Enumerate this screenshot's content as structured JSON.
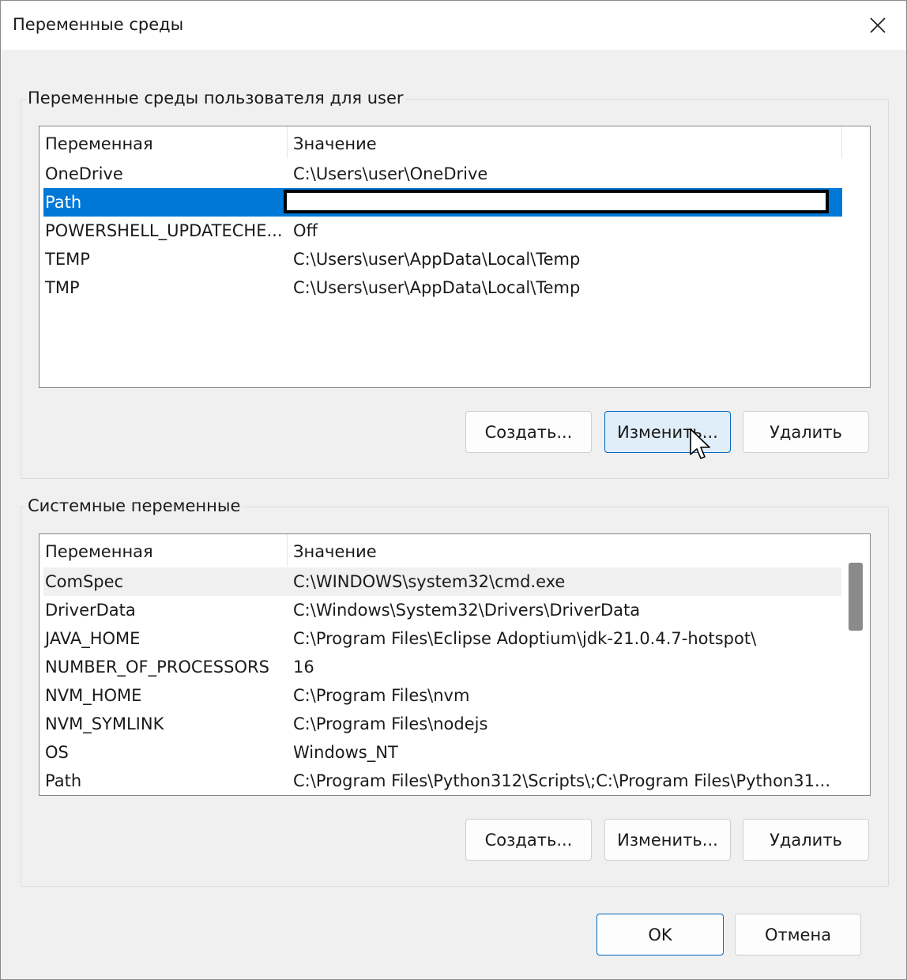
{
  "window": {
    "title": "Переменные среды"
  },
  "user_group": {
    "label": "Переменные среды пользователя для user",
    "columns": [
      "Переменная",
      "Значение"
    ],
    "rows": [
      {
        "name": "OneDrive",
        "value": "C:\\Users\\user\\OneDrive"
      },
      {
        "name": "Path",
        "value": ""
      },
      {
        "name": "POWERSHELL_UPDATECHE...",
        "value": "Off"
      },
      {
        "name": "TEMP",
        "value": "C:\\Users\\user\\AppData\\Local\\Temp"
      },
      {
        "name": "TMP",
        "value": "C:\\Users\\user\\AppData\\Local\\Temp"
      }
    ],
    "buttons": {
      "create": "Создать...",
      "edit": "Изменить...",
      "delete": "Удалить"
    }
  },
  "system_group": {
    "label": "Системные переменные",
    "columns": [
      "Переменная",
      "Значение"
    ],
    "rows": [
      {
        "name": "ComSpec",
        "value": "C:\\WINDOWS\\system32\\cmd.exe"
      },
      {
        "name": "DriverData",
        "value": "C:\\Windows\\System32\\Drivers\\DriverData"
      },
      {
        "name": "JAVA_HOME",
        "value": "C:\\Program Files\\Eclipse Adoptium\\jdk-21.0.4.7-hotspot\\"
      },
      {
        "name": "NUMBER_OF_PROCESSORS",
        "value": "16"
      },
      {
        "name": "NVM_HOME",
        "value": "C:\\Program Files\\nvm"
      },
      {
        "name": "NVM_SYMLINK",
        "value": "C:\\Program Files\\nodejs"
      },
      {
        "name": "OS",
        "value": "Windows_NT"
      },
      {
        "name": "Path",
        "value": "C:\\Program Files\\Python312\\Scripts\\;C:\\Program Files\\Python31..."
      }
    ],
    "buttons": {
      "create": "Создать...",
      "edit": "Изменить...",
      "delete": "Удалить"
    }
  },
  "footer": {
    "ok": "OK",
    "cancel": "Отмена"
  },
  "colors": {
    "selection": "#0078d7",
    "accent": "#0067c0"
  }
}
